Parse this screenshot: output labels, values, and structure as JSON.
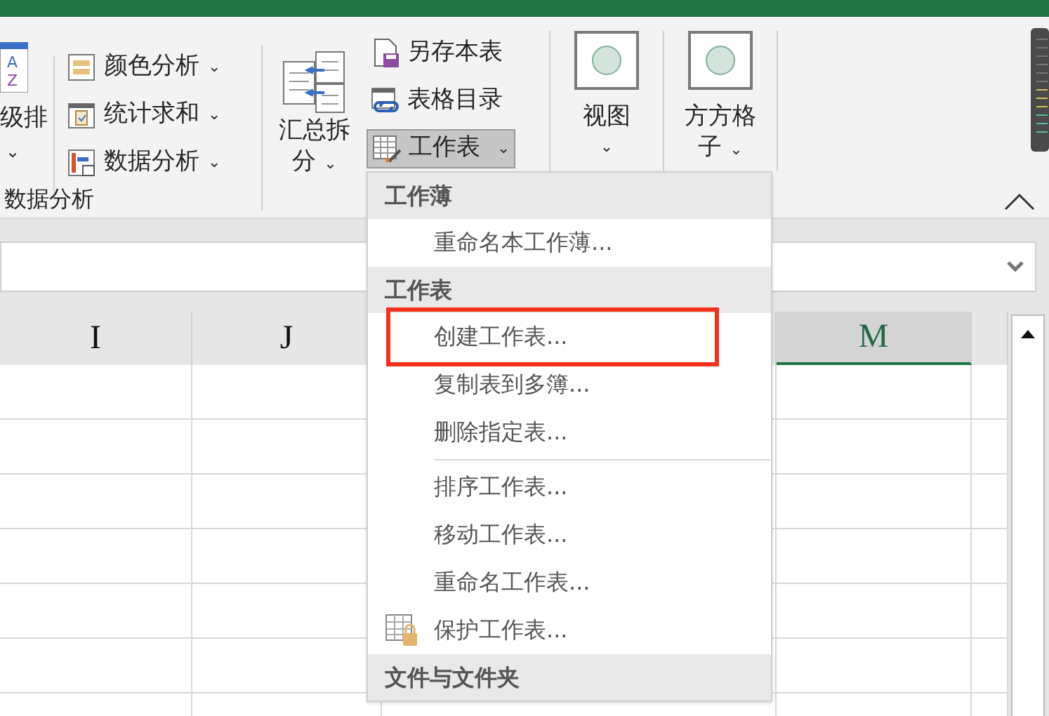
{
  "ribbon": {
    "sort_icon_letters": [
      "A",
      "Z"
    ],
    "sort_button": {
      "label": "级排",
      "caret": "⌄"
    },
    "small_buttons": [
      {
        "kind": "color",
        "label": "颜色分析",
        "caret": "⌄"
      },
      {
        "kind": "sum",
        "label": "统计求和",
        "caret": "⌄"
      },
      {
        "kind": "data",
        "label": "数据分析",
        "caret": "⌄"
      }
    ],
    "group_label": "数据分析",
    "summary_button": {
      "label_1": "汇总拆",
      "label_2": "分",
      "caret": "⌄"
    },
    "sheet_buttons": [
      {
        "kind": "save",
        "label": "另存本表",
        "selected": false
      },
      {
        "kind": "catalog",
        "label": "表格目录",
        "selected": false
      },
      {
        "kind": "sheet",
        "label": "工作表",
        "caret": "⌄",
        "selected": true
      }
    ],
    "view_button": {
      "label": "视图",
      "caret": "⌄"
    },
    "grid_button": {
      "label_1": "方方格",
      "label_2": "子",
      "caret": "⌄"
    }
  },
  "columns": [
    {
      "label": "I",
      "selected": false
    },
    {
      "label": "J",
      "selected": false
    },
    {
      "selected": false
    },
    {
      "label": "M",
      "selected": true
    },
    {
      "selected": false
    }
  ],
  "menu": [
    {
      "kind": "header",
      "label": "工作薄"
    },
    {
      "kind": "item",
      "label": "重命名本工作薄..."
    },
    {
      "kind": "header",
      "label": "工作表"
    },
    {
      "kind": "item",
      "label": "创建工作表...",
      "highlighted": true
    },
    {
      "kind": "item",
      "label": "复制表到多簿..."
    },
    {
      "kind": "item",
      "label": "删除指定表..."
    },
    {
      "kind": "divider"
    },
    {
      "kind": "item",
      "label": "排序工作表..."
    },
    {
      "kind": "item",
      "label": "移动工作表..."
    },
    {
      "kind": "item",
      "label": "重命名工作表..."
    },
    {
      "kind": "item",
      "label": "保护工作表...",
      "icon": true
    },
    {
      "kind": "header",
      "label": "文件与文件夹"
    }
  ]
}
